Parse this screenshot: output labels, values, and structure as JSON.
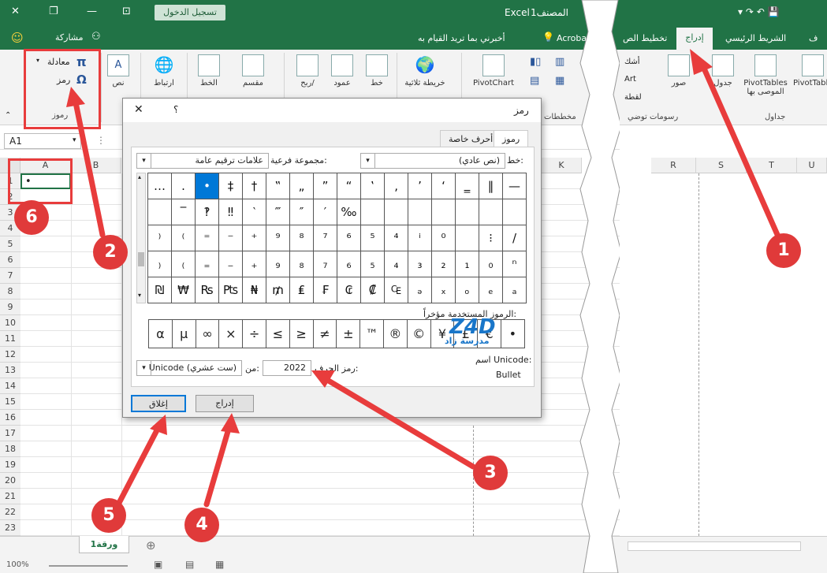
{
  "titlebar": {
    "app": "Excel",
    "book": "المصنف1",
    "sign_in": "تسجيل الدخول"
  },
  "tellbar": {
    "share": "مشاركة",
    "tell_me": "أخبرني بما تريد القيام به",
    "acrobat": "Acrobat"
  },
  "ribbon": {
    "equation": "معادلة",
    "symbol": "رمز",
    "symbols_group": "رموز",
    "text": "نص",
    "link": "ارتباط",
    "line_sparkline": "الخط",
    "slicer": "مقسم",
    "winloss": "ربح/",
    "column": "عمود",
    "line": "خط",
    "map3d": "خريطة ثلاثية",
    "pivotchart": "PivotChart",
    "charts_group": "مخططات"
  },
  "right_ribbon": {
    "tab_file": "ف",
    "tab_home": "الشريط الرئيسي",
    "tab_insert": "إدراج",
    "tab_layout": "تخطيط الص",
    "pivottable": "PivotTable",
    "recommended_line1": "PivotTables",
    "recommended_line2": "الموصى بها",
    "table": "جدول",
    "pictures": "صور",
    "shapes": "أشك",
    "smartart": "Art",
    "screenshot": "لقطة",
    "tables_group": "جداول",
    "illustrations_group": "رسومات توضي"
  },
  "namebox": "A1",
  "columns_left": [
    "A",
    "B"
  ],
  "columns_dlg": [
    "K"
  ],
  "columns_right": [
    "R",
    "S",
    "T",
    "U"
  ],
  "rows": [
    "1",
    "2",
    "3",
    "4",
    "5",
    "6",
    "7",
    "8",
    "9",
    "10",
    "11",
    "12",
    "13",
    "14",
    "15",
    "16",
    "17",
    "18",
    "19",
    "20",
    "21",
    "22",
    "23"
  ],
  "cell_a1": "•",
  "sheet_tab": "ورقة1",
  "zoom": "100%",
  "dialog": {
    "title": "رمز",
    "help": "؟",
    "close": "✕",
    "tab_symbols": "رموز",
    "tab_special": "أحرف خاصة",
    "font_label": "خط:",
    "font_value": "(نص عادي)",
    "subset_label": "مجموعة فرعية:",
    "subset_value": "علامات ترقيم عامة",
    "grid_rows": [
      [
        "—",
        "‖",
        "‗",
        "‘",
        "’",
        "‚",
        "‛",
        "“",
        "”",
        "„",
        "‟",
        "†",
        "‡",
        "•",
        "․",
        "…"
      ],
      [
        "",
        "",
        "",
        "",
        "",
        "",
        "",
        "‰",
        "′",
        "″",
        "‴",
        "‵",
        "‼",
        "‽",
        "‾",
        ""
      ],
      [
        "/",
        "⁝",
        "",
        "⁰",
        "ⁱ",
        "⁴",
        "⁵",
        "⁶",
        "⁷",
        "⁸",
        "⁹",
        "⁺",
        "⁻",
        "⁼",
        "⁽",
        "⁾"
      ],
      [
        "ⁿ",
        "₀",
        "₁",
        "₂",
        "₃",
        "₄",
        "₅",
        "₆",
        "₇",
        "₈",
        "₉",
        "₊",
        "₋",
        "₌",
        "₍",
        "₎"
      ],
      [
        "ₐ",
        "ₑ",
        "ₒ",
        "ₓ",
        "ₔ",
        "₠",
        "₡",
        "₢",
        "₣",
        "₤",
        "₥",
        "₦",
        "₧",
        "₨",
        "₩",
        "₪"
      ]
    ],
    "recent_label": "الرموز المستخدمة مؤخراً:",
    "recent": [
      "•",
      "€",
      "£",
      "¥",
      "©",
      "®",
      "™",
      "±",
      "≠",
      "≥",
      "≤",
      "÷",
      "×",
      "∞",
      "µ",
      "α"
    ],
    "unicode_name_label": "اسم Unicode:",
    "unicode_name": "Bullet",
    "char_code_label": "رمز الحرف:",
    "char_code": "2022",
    "from_label": "من:",
    "from_value": "Unicode (ست عشري)",
    "insert": "إدراج",
    "close_btn": "إغلاق"
  },
  "watermark": "مدرسة زاد",
  "callouts": [
    "1",
    "2",
    "3",
    "4",
    "5",
    "6"
  ],
  "colors": {
    "excel_green": "#217346",
    "callout_red": "#e03a3a",
    "selection_blue": "#0078d7"
  }
}
